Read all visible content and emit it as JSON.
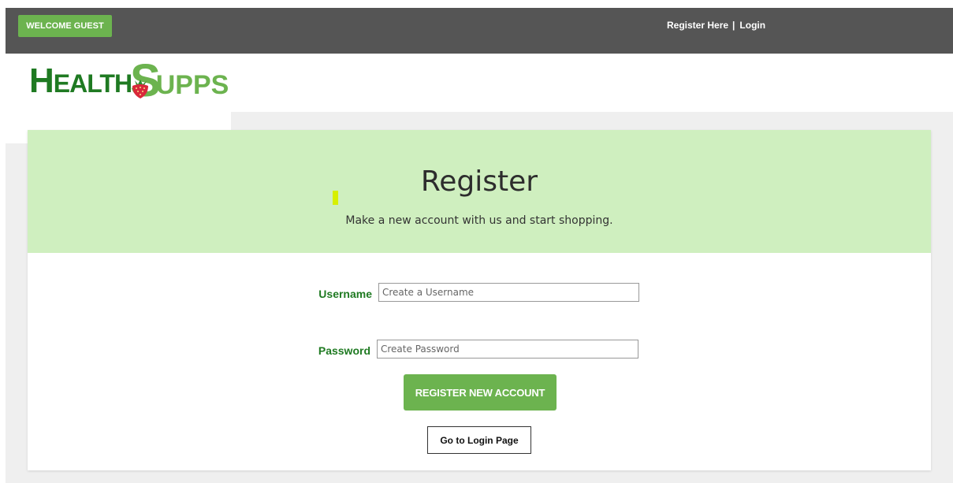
{
  "topbar": {
    "welcome_label": "WELCOME GUEST",
    "register_link": "Register Here",
    "separator": "|",
    "login_link": "Login"
  },
  "logo": {
    "health_first": "H",
    "health_rest": "EALTH",
    "s_letter": "S",
    "supps_rest": "UPPS"
  },
  "form": {
    "title": "Register",
    "subtitle": "Make a new account with us and start shopping.",
    "username_label": "Username",
    "username_placeholder": "Create a Username",
    "username_value": "",
    "password_label": "Password",
    "password_placeholder": "Create Password",
    "password_value": "",
    "submit_label": "REGISTER NEW ACCOUNT",
    "login_page_label": "Go to Login Page"
  },
  "colors": {
    "topbar": "#555555",
    "brand_green": "#6cb34f",
    "dark_green": "#1f7a22",
    "header_bg": "#cfefbf"
  }
}
